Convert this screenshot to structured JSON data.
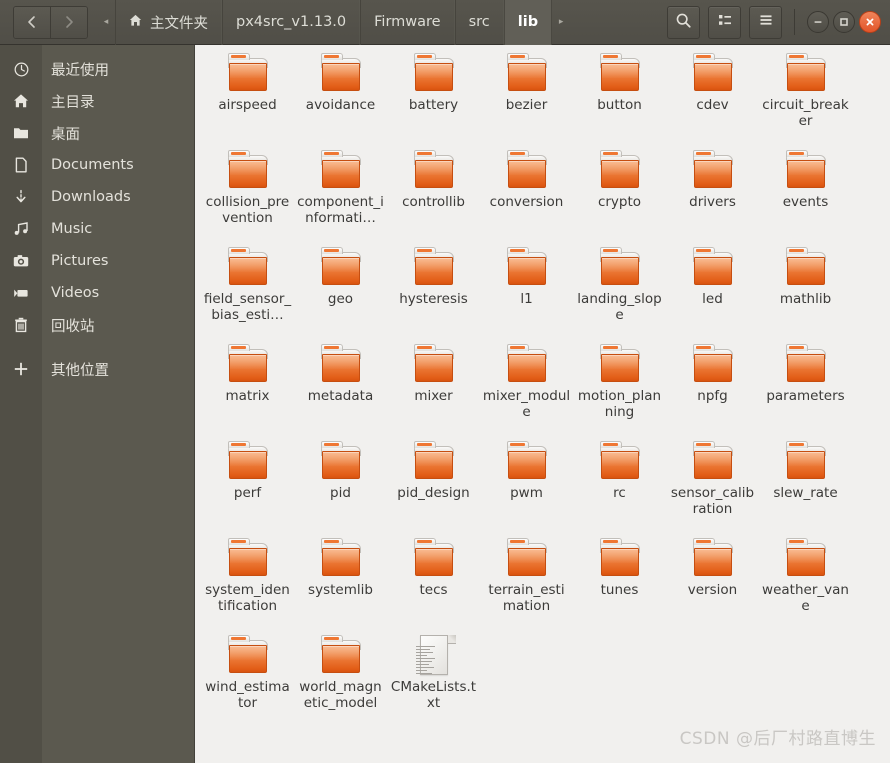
{
  "window": {
    "title": "lib",
    "nav": {
      "back_label": "‹",
      "forward_label": "›"
    },
    "controls": {
      "minimize_label": "–",
      "maximize_label": "□",
      "close_label": "×"
    },
    "toolbar": {
      "search_label": "search-icon",
      "view_toggle_label": "list-view-icon",
      "menu_label": "hamburger-menu-icon"
    }
  },
  "breadcrumb": {
    "prev_arrow": "◂",
    "next_arrow": "▸",
    "items": [
      {
        "label": "主文件夹",
        "icon": "home-icon",
        "active": false
      },
      {
        "label": "px4src_v1.13.0",
        "active": false
      },
      {
        "label": "Firmware",
        "active": false
      },
      {
        "label": "src",
        "active": false
      },
      {
        "label": "lib",
        "active": true
      }
    ]
  },
  "sidebar": {
    "items": [
      {
        "label": "最近使用",
        "icon": "clock-icon"
      },
      {
        "label": "主目录",
        "icon": "home-icon"
      },
      {
        "label": "桌面",
        "icon": "folder-icon"
      },
      {
        "label": "Documents",
        "icon": "document-icon"
      },
      {
        "label": "Downloads",
        "icon": "download-icon"
      },
      {
        "label": "Music",
        "icon": "music-icon"
      },
      {
        "label": "Pictures",
        "icon": "camera-icon"
      },
      {
        "label": "Videos",
        "icon": "video-icon"
      },
      {
        "label": "回收站",
        "icon": "trash-icon"
      },
      {
        "label": "其他位置",
        "icon": "plus-icon"
      }
    ]
  },
  "files": [
    {
      "name": "airspeed",
      "type": "folder"
    },
    {
      "name": "avoidance",
      "type": "folder"
    },
    {
      "name": "battery",
      "type": "folder"
    },
    {
      "name": "bezier",
      "type": "folder"
    },
    {
      "name": "button",
      "type": "folder"
    },
    {
      "name": "cdev",
      "type": "folder"
    },
    {
      "name": "circuit_breaker",
      "type": "folder"
    },
    {
      "name": "collision_prevention",
      "type": "folder"
    },
    {
      "name": "component_informati…",
      "type": "folder"
    },
    {
      "name": "controllib",
      "type": "folder"
    },
    {
      "name": "conversion",
      "type": "folder"
    },
    {
      "name": "crypto",
      "type": "folder"
    },
    {
      "name": "drivers",
      "type": "folder"
    },
    {
      "name": "events",
      "type": "folder"
    },
    {
      "name": "field_sensor_bias_esti…",
      "type": "folder"
    },
    {
      "name": "geo",
      "type": "folder"
    },
    {
      "name": "hysteresis",
      "type": "folder"
    },
    {
      "name": "l1",
      "type": "folder"
    },
    {
      "name": "landing_slope",
      "type": "folder"
    },
    {
      "name": "led",
      "type": "folder"
    },
    {
      "name": "mathlib",
      "type": "folder"
    },
    {
      "name": "matrix",
      "type": "folder"
    },
    {
      "name": "metadata",
      "type": "folder"
    },
    {
      "name": "mixer",
      "type": "folder"
    },
    {
      "name": "mixer_module",
      "type": "folder"
    },
    {
      "name": "motion_planning",
      "type": "folder"
    },
    {
      "name": "npfg",
      "type": "folder"
    },
    {
      "name": "parameters",
      "type": "folder"
    },
    {
      "name": "perf",
      "type": "folder"
    },
    {
      "name": "pid",
      "type": "folder"
    },
    {
      "name": "pid_design",
      "type": "folder"
    },
    {
      "name": "pwm",
      "type": "folder"
    },
    {
      "name": "rc",
      "type": "folder"
    },
    {
      "name": "sensor_calibration",
      "type": "folder"
    },
    {
      "name": "slew_rate",
      "type": "folder"
    },
    {
      "name": "system_identification",
      "type": "folder"
    },
    {
      "name": "systemlib",
      "type": "folder"
    },
    {
      "name": "tecs",
      "type": "folder"
    },
    {
      "name": "terrain_estimation",
      "type": "folder"
    },
    {
      "name": "tunes",
      "type": "folder"
    },
    {
      "name": "version",
      "type": "folder"
    },
    {
      "name": "weather_vane",
      "type": "folder"
    },
    {
      "name": "wind_estimator",
      "type": "folder"
    },
    {
      "name": "world_magnetic_model",
      "type": "folder"
    },
    {
      "name": "CMakeLists.txt",
      "type": "text"
    }
  ],
  "watermark": {
    "text": "CSDN @后厂村路直博生"
  },
  "colors": {
    "header_bg": "#524f48",
    "sidebar_bg": "#5b594f",
    "content_bg": "#f1f0ee",
    "folder_orange": "#e97331",
    "close_button": "#e2552a",
    "text_light": "#e4e2db",
    "text_dark": "#3c3b39"
  }
}
